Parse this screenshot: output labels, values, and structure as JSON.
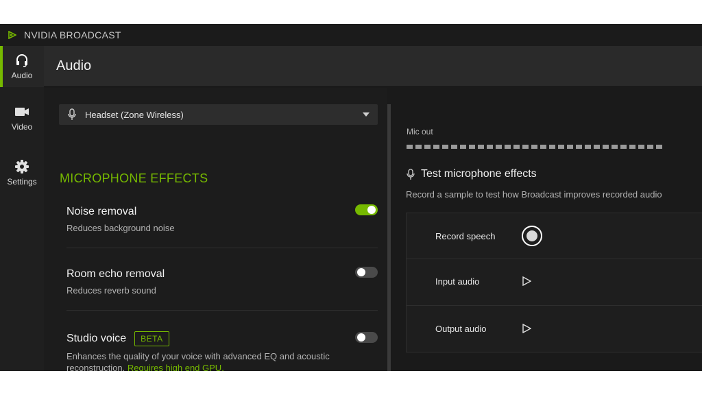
{
  "app": {
    "title": "NVIDIA BROADCAST"
  },
  "sidebar": {
    "items": [
      {
        "label": "Audio",
        "icon": "headset-icon",
        "active": true
      },
      {
        "label": "Video",
        "icon": "video-camera-icon",
        "active": false
      },
      {
        "label": "Settings",
        "icon": "gear-icon",
        "active": false
      }
    ]
  },
  "header": {
    "title": "Audio"
  },
  "device": {
    "selected": "Headset (Zone Wireless)",
    "icon": "microphone-icon"
  },
  "effects": {
    "heading": "MICROPHONE EFFECTS",
    "items": [
      {
        "title": "Noise removal",
        "description": "Reduces background noise",
        "enabled": true
      },
      {
        "title": "Room echo removal",
        "description": "Reduces reverb sound",
        "enabled": false
      },
      {
        "title": "Studio voice",
        "badge": "BETA",
        "description": "Enhances the quality of your voice with advanced EQ and acoustic reconstruction.",
        "description_highlight": "Requires high end GPU.",
        "enabled": false
      }
    ]
  },
  "output": {
    "mic_out_label": "Mic out",
    "meter_segments": 29
  },
  "test": {
    "title": "Test microphone effects",
    "description": "Record a sample to test how Broadcast improves recorded audio",
    "rows": [
      {
        "label": "Record speech",
        "icon": "record-icon"
      },
      {
        "label": "Input audio",
        "icon": "play-icon"
      },
      {
        "label": "Output audio",
        "icon": "play-icon"
      }
    ]
  },
  "colors": {
    "accent": "#76b900",
    "background": "#1a1a1a",
    "text": "#f0f0f0"
  }
}
